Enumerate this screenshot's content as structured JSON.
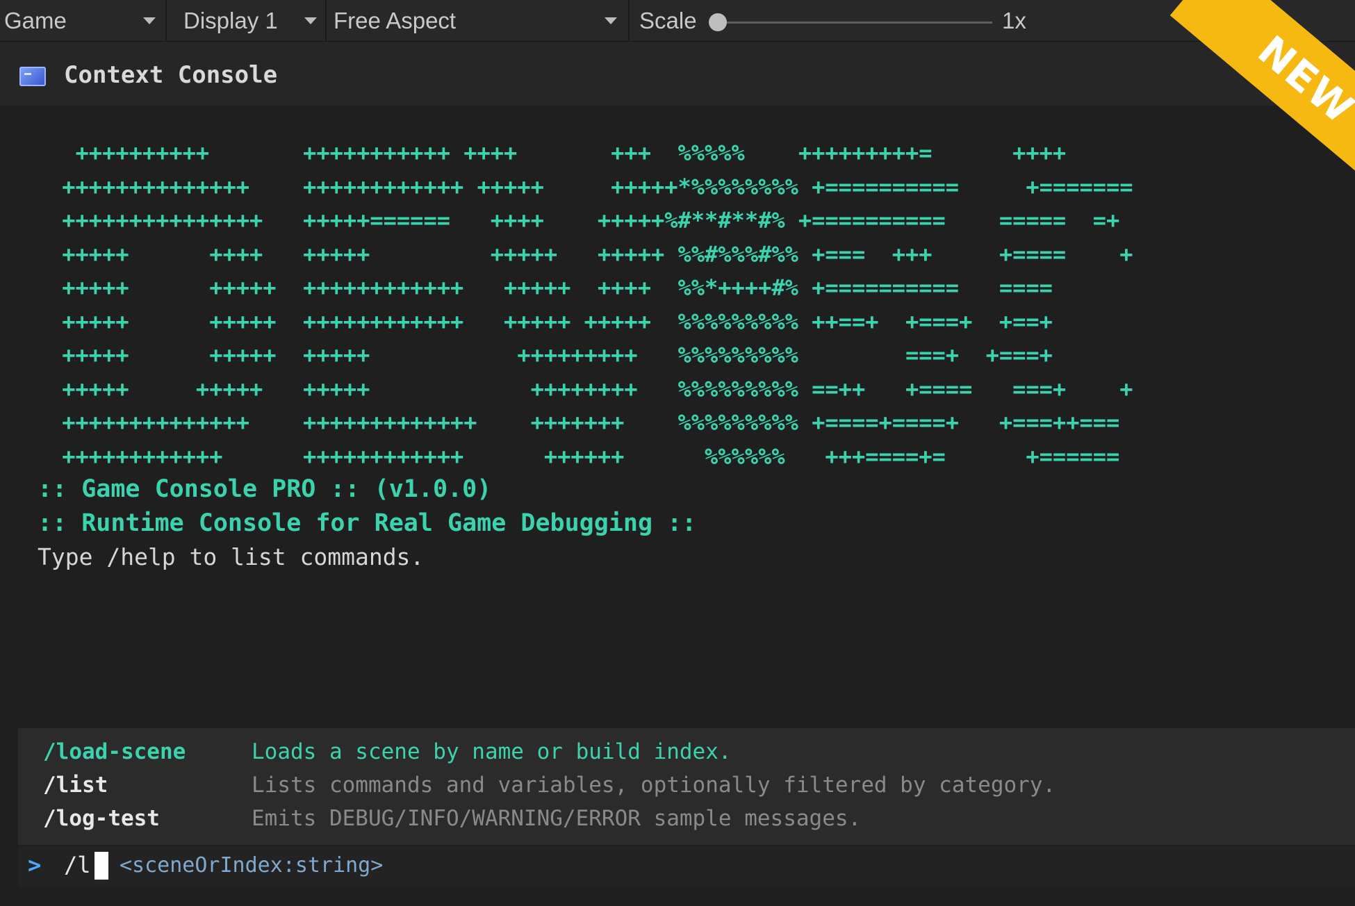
{
  "toolbar": {
    "view_mode": "Game",
    "display": "Display 1",
    "aspect": "Free Aspect",
    "scale_label": "Scale",
    "scale_value": "1x",
    "scale_slider_fraction": 0.0
  },
  "window": {
    "title": "Context Console",
    "icon": "console-window-icon"
  },
  "console": {
    "ascii_art": [
      "  ++++++++++       +++++++++++ ++++       +++  %%%%%    +++++++++=      ++++",
      " ++++++++++++++    ++++++++++++ +++++     +++++*%%%%%%%% +==========     +=======",
      " +++++++++++++++   +++++======   ++++    +++++%#**#**#% +==========    =====  =+",
      " +++++      ++++   +++++         +++++   +++++ %%#%%%#%% +===  +++     +====    +",
      " +++++      +++++  ++++++++++++   +++++  ++++  %%*++++#% +==========   ====",
      " +++++      +++++  ++++++++++++   +++++ +++++  %%%%%%%%% ++==+  +===+  +==+",
      " +++++      +++++  +++++           +++++++++   %%%%%%%%%        ===+  +===+",
      " +++++     +++++   +++++            ++++++++   %%%%%%%%% ==++   +====   ===+    +",
      " ++++++++++++++    +++++++++++++    +++++++    %%%%%%%%% +====+====+   +===++===",
      " ++++++++++++      ++++++++++++      ++++++      %%%%%%   +++====+=      +======"
    ],
    "banner_line_1": ":: Game Console PRO :: (v1.0.0)",
    "banner_line_2": ":: Runtime Console for Real Game Debugging ::",
    "hint": "Type /help to list commands."
  },
  "suggestions": [
    {
      "command": "/load-scene",
      "description": "Loads a scene by name or build index."
    },
    {
      "command": "/list",
      "description": "Lists commands and variables, optionally filtered by category."
    },
    {
      "command": "/log-test",
      "description": "Emits DEBUG/INFO/WARNING/ERROR sample messages."
    }
  ],
  "input": {
    "prompt": ">",
    "value": "/l",
    "argument_hint": "<sceneOrIndex:string>"
  },
  "badge": {
    "label": "NEW",
    "color": "#f5b912"
  },
  "colors": {
    "accent": "#3bd3ae",
    "prompt": "#4fa8ff",
    "background": "#1f1f1f"
  }
}
